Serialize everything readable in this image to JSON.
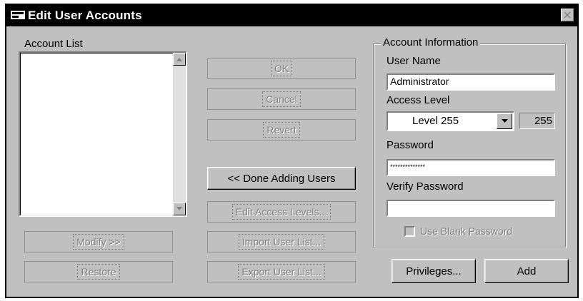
{
  "window": {
    "title": "Edit User Accounts",
    "icon": "window-app-icon",
    "close_icon": "close-x-icon"
  },
  "account_list": {
    "label": "Account List",
    "items": [],
    "scroll_up_icon": "triangle-up-icon",
    "scroll_down_icon": "triangle-down-icon"
  },
  "buttons": {
    "modify": "Modify >>",
    "restore": "Restore",
    "ok": "OK",
    "cancel": "Cancel",
    "revert": "Revert",
    "done_adding": "<< Done Adding Users",
    "edit_access_levels": "Edit Access Levels...",
    "import_user_list": "Import User List...",
    "export_user_list": "Export User List...",
    "privileges": "Privileges...",
    "add": "Add"
  },
  "account_info": {
    "group_title": "Account Information",
    "user_name_label": "User Name",
    "user_name_value": "Administrator",
    "access_level_label": "Access Level",
    "access_level_selected": "Level 255",
    "access_level_number": "255",
    "password_label": "Password",
    "password_value": "**************",
    "verify_password_label": "Verify Password",
    "verify_password_value": "",
    "blank_password_label": "Use Blank Password",
    "blank_password_checked": false
  }
}
